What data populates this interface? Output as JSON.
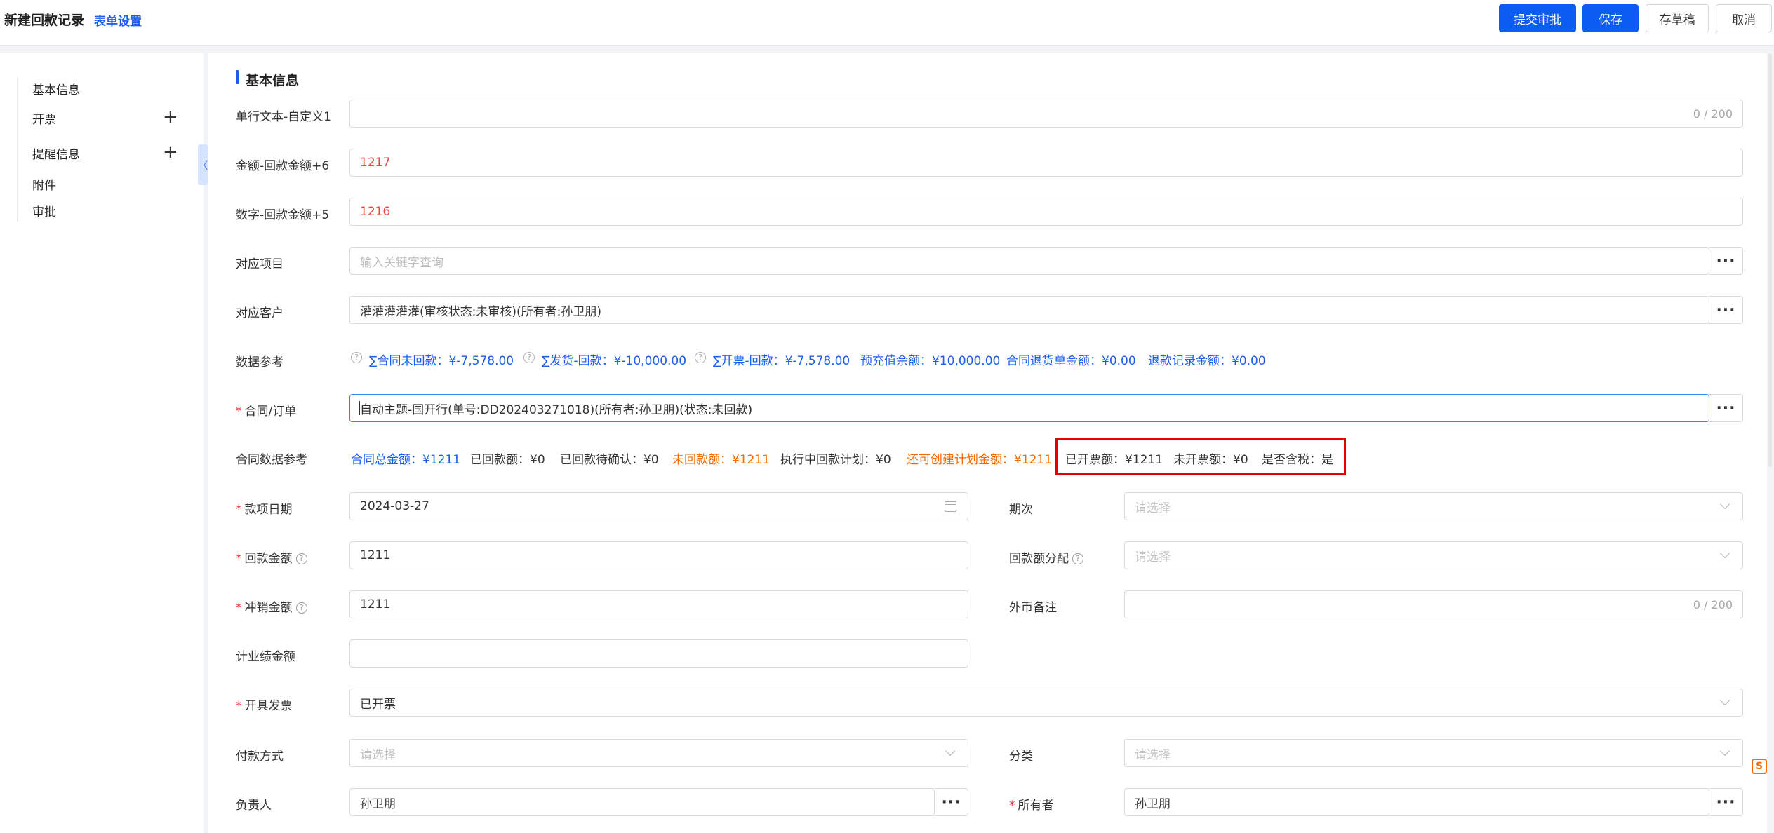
{
  "header": {
    "title": "新建回款记录",
    "form_settings": "表单设置",
    "buttons": {
      "submit": "提交审批",
      "save": "保存",
      "draft": "存草稿",
      "cancel": "取消"
    }
  },
  "sidebar": {
    "items": [
      {
        "label": "基本信息",
        "expandable": false
      },
      {
        "label": "开票",
        "expandable": true
      },
      {
        "label": "提醒信息",
        "expandable": true
      },
      {
        "label": "附件",
        "expandable": false
      },
      {
        "label": "审批",
        "expandable": false
      }
    ],
    "plus": "+",
    "collapse_glyph": "〈"
  },
  "section": {
    "title": "基本信息"
  },
  "fields": {
    "text1": {
      "label": "单行文本-自定义1",
      "value": "",
      "count": "0 / 200"
    },
    "amount6": {
      "label": "金额-回款金额+6",
      "value": "1217"
    },
    "number5": {
      "label": "数字-回款金额+5",
      "value": "1216"
    },
    "project": {
      "label": "对应项目",
      "placeholder": "输入关键字查询"
    },
    "customer": {
      "label": "对应客户",
      "value": "灌灌灌灌灌(审核状态:未审核)(所有者:孙卫朋)"
    },
    "data_ref": {
      "label": "数据参考",
      "items": [
        "∑合同未回款：¥-7,578.00",
        "∑发货-回款：¥-10,000.00",
        "∑开票-回款：¥-7,578.00",
        "预充值余额：¥10,000.00",
        "合同退货单金额：¥0.00",
        "退款记录金额：¥0.00"
      ]
    },
    "contract": {
      "label": "合同/订单",
      "required": "*",
      "value": "自动主题-国开行(单号:DD202403271018)(所有者:孙卫朋)(状态:未回款)"
    },
    "contract_ref": {
      "label": "合同数据参考",
      "items": [
        "合同总金额：¥1211",
        "已回款额：¥0",
        "已回款待确认：¥0",
        "未回款额：¥1211",
        "执行中回款计划：¥0",
        "还可创建计划金额：¥1211",
        "已开票额：¥1211",
        "未开票额：¥0",
        "是否含税：是"
      ]
    },
    "due_date": {
      "label": "款项日期",
      "required": "*",
      "value": "2024-03-27"
    },
    "period": {
      "label": "期次",
      "placeholder": "请选择"
    },
    "payment_amount": {
      "label": "回款金额",
      "required": "*",
      "value": "1211"
    },
    "allocation": {
      "label": "回款额分配",
      "placeholder": "请选择"
    },
    "writeoff": {
      "label": "冲销金额",
      "required": "*",
      "value": "1211"
    },
    "fx_note": {
      "label": "外币备注",
      "value": "",
      "count": "0 / 200"
    },
    "commission": {
      "label": "计业绩金额",
      "value": ""
    },
    "invoice": {
      "label": "开具发票",
      "required": "*",
      "value": "已开票"
    },
    "pay_method": {
      "label": "付款方式",
      "placeholder": "请选择"
    },
    "category": {
      "label": "分类",
      "placeholder": "请选择"
    },
    "owner_person": {
      "label": "负责人",
      "value": "孙卫朋"
    },
    "owner": {
      "label": "所有者",
      "required": "*",
      "value": "孙卫朋"
    }
  },
  "more_glyph": "···",
  "help_glyph": "?",
  "fab_glyph": "S",
  "colors": {
    "primary": "#0b5cf2",
    "link": "#1a5ef0",
    "warning": "#f56a00",
    "required": "#f5222d",
    "highlight_box": "#e00000"
  }
}
